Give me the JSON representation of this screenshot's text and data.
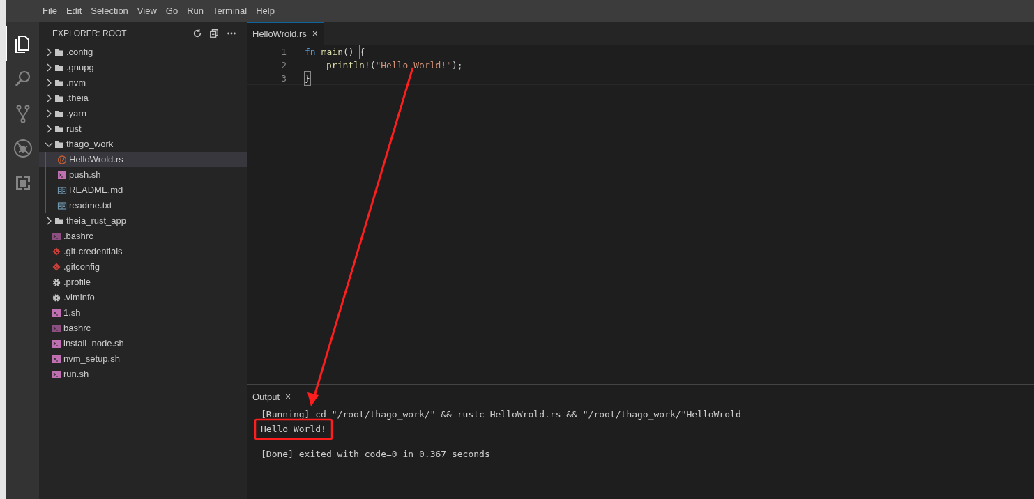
{
  "menu_bar": [
    "File",
    "Edit",
    "Selection",
    "View",
    "Go",
    "Run",
    "Terminal",
    "Help"
  ],
  "activity_bar": [
    {
      "kind": "files",
      "selected": true
    },
    {
      "kind": "search",
      "selected": false
    },
    {
      "kind": "source-control",
      "selected": false
    },
    {
      "kind": "debug",
      "selected": false
    },
    {
      "kind": "extensions",
      "selected": false
    }
  ],
  "explorer": {
    "title": "EXPLORER: ROOT",
    "tree": [
      {
        "label": ".config",
        "kind": "folder",
        "expanded": false,
        "selected": false
      },
      {
        "label": ".gnupg",
        "kind": "folder",
        "expanded": false,
        "selected": false
      },
      {
        "label": ".nvm",
        "kind": "folder",
        "expanded": false,
        "selected": false
      },
      {
        "label": ".theia",
        "kind": "folder",
        "expanded": false,
        "selected": false
      },
      {
        "label": ".yarn",
        "kind": "folder",
        "expanded": false,
        "selected": false
      },
      {
        "label": "rust",
        "kind": "folder",
        "expanded": false,
        "selected": false
      },
      {
        "label": "thago_work",
        "kind": "folder",
        "expanded": true,
        "selected": false,
        "children": [
          {
            "label": "HelloWrold.rs",
            "kind": "rust",
            "selected": true
          },
          {
            "label": "push.sh",
            "kind": "shell",
            "selected": false
          },
          {
            "label": "README.md",
            "kind": "doc",
            "selected": false
          },
          {
            "label": "readme.txt",
            "kind": "doc",
            "selected": false
          }
        ]
      },
      {
        "label": "theia_rust_app",
        "kind": "folder",
        "expanded": false,
        "selected": false
      },
      {
        "label": ".bashrc",
        "kind": "shell-dark",
        "selected": false
      },
      {
        "label": ".git-credentials",
        "kind": "git",
        "selected": false
      },
      {
        "label": ".gitconfig",
        "kind": "git",
        "selected": false
      },
      {
        "label": ".profile",
        "kind": "settings",
        "selected": false
      },
      {
        "label": ".viminfo",
        "kind": "settings",
        "selected": false
      },
      {
        "label": "1.sh",
        "kind": "shell",
        "selected": false
      },
      {
        "label": "bashrc",
        "kind": "shell-dark",
        "selected": false
      },
      {
        "label": "install_node.sh",
        "kind": "shell",
        "selected": false
      },
      {
        "label": "nvm_setup.sh",
        "kind": "shell",
        "selected": false
      },
      {
        "label": "run.sh",
        "kind": "shell",
        "selected": false
      }
    ]
  },
  "editor": {
    "tabs": [
      {
        "label": "HelloWrold.rs",
        "close": "×",
        "selected": true
      }
    ],
    "lines": [
      {
        "number": "1",
        "indented": false,
        "tokens": [
          {
            "kind": "keyword",
            "text": "fn"
          },
          {
            "kind": "function",
            "text": "main"
          },
          {
            "kind": "plain",
            "text": "()"
          },
          {
            "kind": "bracket",
            "text": "{"
          }
        ]
      },
      {
        "number": "2",
        "indented": true,
        "tokens": [
          {
            "kind": "function",
            "text": "println!"
          },
          {
            "kind": "plain",
            "text": "("
          },
          {
            "kind": "string",
            "text": "\"Hello World!\""
          },
          {
            "kind": "plain",
            "text": ");"
          }
        ]
      },
      {
        "number": "3",
        "indented": false,
        "tokens": [
          {
            "kind": "bracket",
            "text": "}"
          }
        ]
      }
    ]
  },
  "panel": {
    "tabs": [
      {
        "label": "Output",
        "close": "×",
        "selected": true
      }
    ],
    "output": [
      {
        "text": "[Running] cd \"/root/thago_work/\" && rustc HelloWrold.rs && \"/root/thago_work/\"HelloWrold",
        "spaced": false
      },
      {
        "text": "Hello World!",
        "spaced": false
      },
      {
        "text": "[Done] exited with code=0 in 0.367 seconds",
        "spaced": true
      }
    ]
  }
}
